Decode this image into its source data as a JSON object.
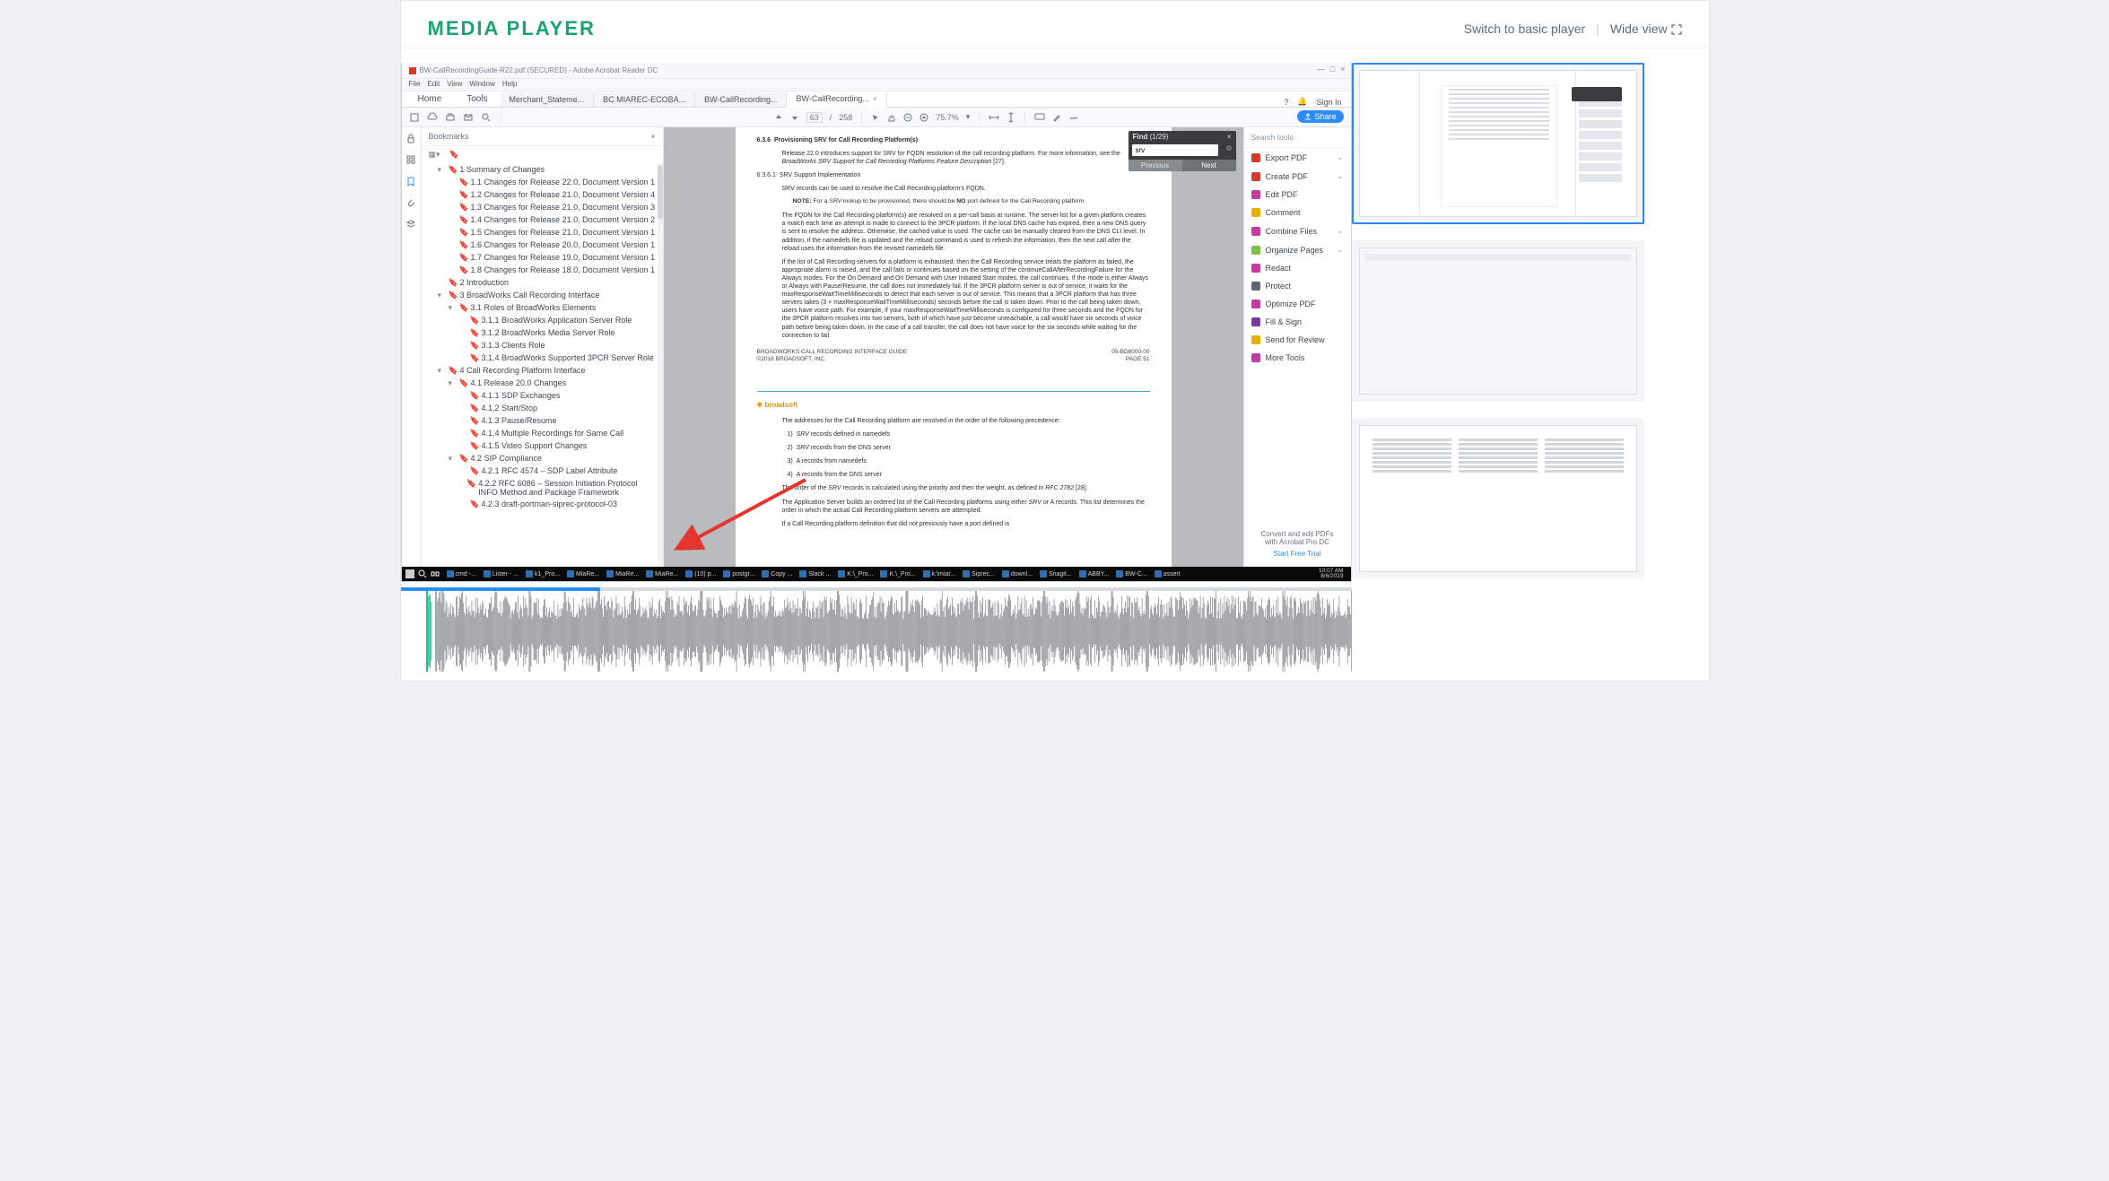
{
  "brand": "MEDIA  PLAYER",
  "top": {
    "switch": "Switch  to  basic  player",
    "divider": "|",
    "wide": "Wide  view"
  },
  "win": {
    "title": "BW-CallRecordingGuide-R22.pdf (SECURED) - Adobe Acrobat Reader DC",
    "menu": [
      "File",
      "Edit",
      "View",
      "Window",
      "Help"
    ],
    "win_min": "—",
    "win_max": "□",
    "win_close": "×",
    "tab_home": "Home",
    "tab_tools": "Tools",
    "tabs": [
      "Merchant_Stateme...",
      "BC MIAREC-ECOBA...",
      "BW-CallRecording...",
      "BW-CallRecording..."
    ],
    "active_tab_index": 3,
    "help_icon": "?",
    "bell_icon": "🔔",
    "signin": "Sign In",
    "share": "Share",
    "page_cur": "63",
    "page_total": "258",
    "zoom": "75.7%",
    "bookmarks_title": "Bookmarks",
    "bookmarks": [
      {
        "d": 1,
        "chev": "v",
        "t": "1 Summary of Changes"
      },
      {
        "d": 2,
        "t": "1.1 Changes for Release 22.0, Document Version 1"
      },
      {
        "d": 2,
        "t": "1.2 Changes for Release 21.0, Document Version 4"
      },
      {
        "d": 2,
        "t": "1.3 Changes for Release 21.0, Document Version 3"
      },
      {
        "d": 2,
        "t": "1.4 Changes for Release 21.0, Document Version 2"
      },
      {
        "d": 2,
        "t": "1.5 Changes for Release 21.0, Document Version 1"
      },
      {
        "d": 2,
        "t": "1.6 Changes for Release 20.0, Document Version 1"
      },
      {
        "d": 2,
        "t": "1.7 Changes for Release 19.0, Document Version 1"
      },
      {
        "d": 2,
        "t": "1.8 Changes for Release 18.0, Document Version 1"
      },
      {
        "d": 1,
        "t": "2 Introduction"
      },
      {
        "d": 1,
        "chev": "v",
        "t": "3 BroadWorks Call Recording Interface"
      },
      {
        "d": 2,
        "chev": "v",
        "t": "3.1 Roles of BroadWorks Elements"
      },
      {
        "d": 3,
        "t": "3.1.1 BroadWorks Application Server Role"
      },
      {
        "d": 3,
        "t": "3.1.2 BroadWorks Media Server Role"
      },
      {
        "d": 3,
        "t": "3.1.3 Clients Role"
      },
      {
        "d": 3,
        "t": "3.1.4 BroadWorks Supported 3PCR Server Role"
      },
      {
        "d": 1,
        "chev": "v",
        "t": "4 Call Recording Platform Interface"
      },
      {
        "d": 2,
        "chev": "v",
        "t": "4.1 Release 20.0 Changes"
      },
      {
        "d": 3,
        "t": "4.1.1 SDP Exchanges"
      },
      {
        "d": 3,
        "t": "4.1.2 Start/Stop"
      },
      {
        "d": 3,
        "t": "4.1.3 Pause/Resume"
      },
      {
        "d": 3,
        "t": "4.1.4 Multiple Recordings for Same Call"
      },
      {
        "d": 3,
        "t": "4.1.5  Video Support Changes"
      },
      {
        "d": 2,
        "chev": "v",
        "t": "4.2 SIP Compliance"
      },
      {
        "d": 3,
        "t": "4.2.1 RFC 4574 – SDP Label Attribute"
      },
      {
        "d": 3,
        "t": "4.2.2 RFC 6086 – Session Initiation Protocol INFO Method and Package Framework"
      },
      {
        "d": 3,
        "t": "4.2.3 draft-portman-siprec-protocol-03"
      }
    ],
    "find": {
      "label": "Find",
      "count": "(1/29)",
      "value": "srv",
      "prev": "Previous",
      "next": "Next",
      "close": "×",
      "gear": "⚙"
    },
    "rhs": {
      "search": "Search tools",
      "tools": [
        {
          "c": "#d23a2a",
          "t": "Export PDF",
          "chev": true
        },
        {
          "c": "#d23a2a",
          "t": "Create PDF",
          "chev": true
        },
        {
          "c": "#c73aa0",
          "t": "Edit PDF"
        },
        {
          "c": "#e4b100",
          "t": "Comment"
        },
        {
          "c": "#c73aa0",
          "t": "Combine Files",
          "chev": true
        },
        {
          "c": "#7bc24a",
          "t": "Organize Pages",
          "chev": true
        },
        {
          "c": "#c73aa0",
          "t": "Redact"
        },
        {
          "c": "#5b6770",
          "t": "Protect"
        },
        {
          "c": "#c73aa0",
          "t": "Optimize PDF"
        },
        {
          "c": "#7b3aa0",
          "t": "Fill & Sign"
        },
        {
          "c": "#e4b100",
          "t": "Send for Review"
        },
        {
          "c": "#c73aa0",
          "t": "More Tools"
        }
      ],
      "promo1": "Convert and edit PDFs",
      "promo2": "with Acrobat Pro DC",
      "cta": "Start Free Trial"
    },
    "doc": {
      "sec_num1": "6.3.6",
      "sec_ttl1": "Provisioning SRV for Call Recording Platform(s)",
      "p1a": "Release 22.0 introduces support for SRV for FQDN resolution of the call recording platform.  For more information, see the ",
      "p1b": "BroadWorks SRV Support for Call Recording Platforms Feature Description",
      "p1c": " [27].",
      "sec_num2": "6.3.6.1",
      "sec_ttl2": "SRV Support Implementation",
      "p2": "SRV records can be used to resolve the Call Recording platform's FQDN.",
      "note_lbl": "NOTE:",
      "note_a": " For a ",
      "note_srv": "SRV",
      "note_b": " lookup to be provisioned, there should be ",
      "note_no": "NO",
      "note_c": " port defined for the Call Recording platform.",
      "p3": "The FQDN for the Call Recording platform(s) are resolved on a per-call basis at runtime. The server list for a given platform creates a match each time an attempt is made to connect to the 3PCR platform.  If the local DNS cache has expired, then a new DNS query is sent to resolve the address.  Otherwise, the cached value is used.  The cache can be manually cleared from the DNS CLI level.  In addition, if the namedefs file is updated and the reload command is used to refresh the information, then the next call after the reload uses the information from the revised namedefs file.",
      "p4": "If the list of Call Recording servers for a platform is exhausted, then the Call Recording service treats the platform as failed, the appropriate alarm is raised, and the call fails or continues based on the setting of the continueCallAfterRecordingFailure for the Always modes.  For the On Demand and On Demand with User Initiated Start modes, the call continues.  If the mode is either Always or Always with Pause/Resume, the call does not immediately fail.  If the 3PCR platform server is out of service, it waits for the maxResponseWaitTimeMilliseconds to detect that each server is out of service.  This means that a 3PCR platform that has three servers takes (3 × maxResponseWaitTimeMilliseconds) seconds before the call is taken down.  Prior to the call being taken down, users have voice path.  For example, if your maxResponseWaitTimeMilliseconds is configured for three seconds and the FQDN for the 3PCR platform resolves into two servers, both of which have just become unreachable, a call would have six seconds of voice path before being taken down.  In the case of a call transfer, the call does not have voice for the six seconds while waiting for the connection to fail.",
      "ftr_l": "BROADWORKS CALL RECORDING INTERFACE GUIDE",
      "ftr_r": "05-BD8000-00",
      "ftr_l2": "©2016 BROADSOFT, INC.",
      "ftr_r2": "PAGE 51",
      "logo": "broadsoft",
      "p5": "The addresses for the Call Recording platform are resolved in the order of the following precedence:",
      "li1_n": "1)",
      "li1_a": "SRV",
      "li1_b": " records defined in namedefs",
      "li2_n": "2)",
      "li2_a": "SRV",
      "li2_b": " records from the DNS server",
      "li3_n": "3)",
      "li3": "A records from namedefs",
      "li4_n": "4)",
      "li4": "A records from the DNS server",
      "p6a": "The order of the ",
      "p6b": "SRV",
      "p6c": " records is calculated using the priority and then the weight, as defined in ",
      "p6d": "RFC 2782",
      "p6e": " [28].",
      "p7a": "The Application Server builds an ordered list of the Call Recording platforms using either ",
      "p7b": "SRV",
      "p7c": " or A records.  This list determines the order in which the actual Call Recording platform servers are attempted.",
      "p8": "If a Call Recording platform definition that did not previously have a port defined is"
    },
    "taskbar": {
      "items": [
        "cmd -...",
        "Lister - ...",
        "k1_Pro...",
        "MiaRe...",
        "MiaRe...",
        "MiaRe...",
        "(10) p...",
        "postgr...",
        "Copy ...",
        "Slack ...",
        "K:\\_Pro...",
        "K:\\_Pro...",
        "k:\\miar...",
        "Siprec...",
        "downl...",
        "Snagit...",
        "ABBY...",
        "BW-C...",
        "assert"
      ],
      "time": "10:07 AM",
      "date": "8/6/2019"
    }
  }
}
